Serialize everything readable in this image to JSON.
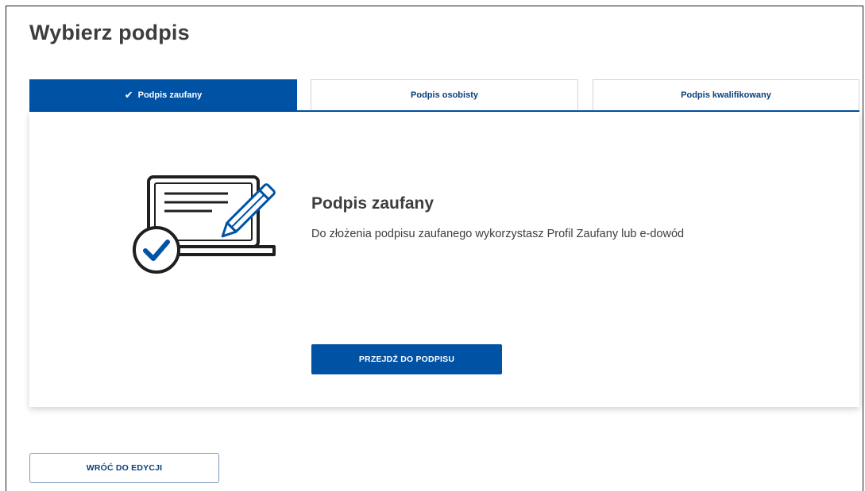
{
  "page": {
    "title": "Wybierz podpis"
  },
  "tabs": [
    {
      "label": "Podpis zaufany",
      "active": true,
      "icon": "check-icon"
    },
    {
      "label": "Podpis osobisty",
      "active": false
    },
    {
      "label": "Podpis kwalifikowany",
      "active": false
    }
  ],
  "option": {
    "title": "Podpis zaufany",
    "description": "Do złożenia podpisu zaufanego wykorzystasz Profil Zaufany lub e-dowód",
    "illustration": "laptop-document-pencil-check-illustration",
    "action_label": "PRZEJDŹ DO PODPISU"
  },
  "footer": {
    "back_label": "WRÓĆ DO EDYCJI"
  },
  "colors": {
    "accent": "#0052a5",
    "text": "#3d3d3d",
    "tab_text": "#0b3f7a"
  }
}
